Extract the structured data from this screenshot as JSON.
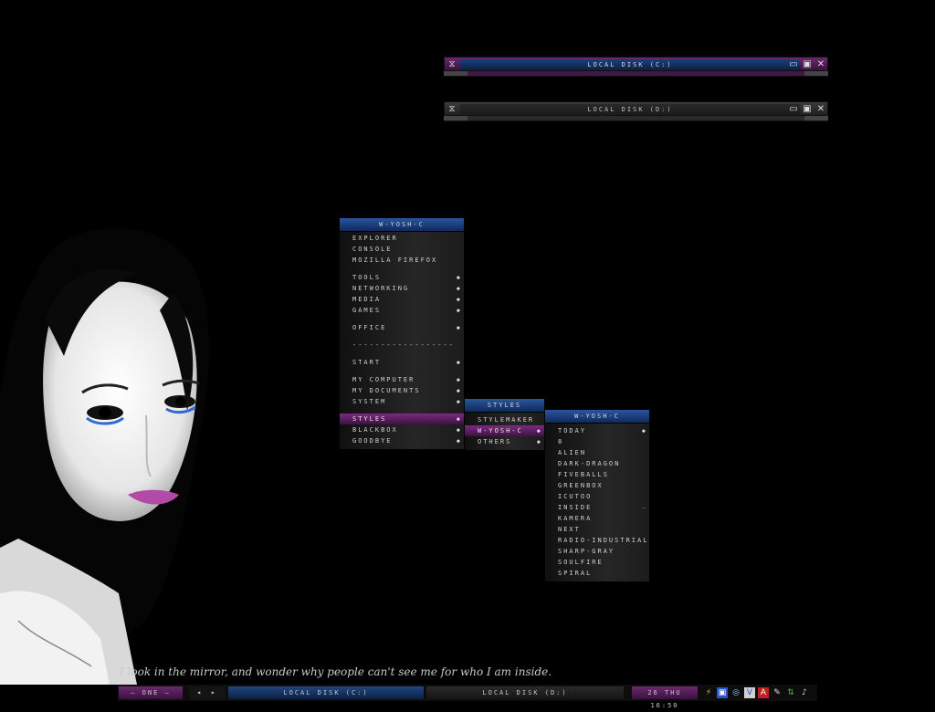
{
  "windows": [
    {
      "title": "LOCAL DISK (C:)",
      "active": true
    },
    {
      "title": "LOCAL DISK (D:)",
      "active": false
    }
  ],
  "window_controls": {
    "menu_icon": "⧖",
    "minimize": "▭",
    "maximize": "▣",
    "close": "✕"
  },
  "menu_main": {
    "title": "W-YOSH-C",
    "items": [
      {
        "label": "EXPLORER"
      },
      {
        "label": "CONSOLE"
      },
      {
        "label": "MOZILLA FIREFOX"
      },
      {
        "label": "TOOLS",
        "arrow": "◆"
      },
      {
        "label": "NETWORKING",
        "arrow": "◆"
      },
      {
        "label": "MEDIA",
        "arrow": "◆"
      },
      {
        "label": "GAMES",
        "arrow": "◆"
      },
      {
        "label": "OFFICE",
        "arrow": "◆"
      },
      {
        "label": "------------------"
      },
      {
        "label": "START",
        "arrow": "◆"
      },
      {
        "label": "MY COMPUTER",
        "arrow": "◆"
      },
      {
        "label": "MY DOCUMENTS",
        "arrow": "◆"
      },
      {
        "label": "SYSTEM",
        "arrow": "◆"
      },
      {
        "label": "STYLES",
        "arrow": "◆"
      },
      {
        "label": "BLACKBOX",
        "arrow": "◆"
      },
      {
        "label": "GOODBYE",
        "arrow": "◆"
      }
    ]
  },
  "menu_styles": {
    "title": "STYLES",
    "items": [
      {
        "label": "STYLEMAKER"
      },
      {
        "label": "W-YOSH-C",
        "arrow": "◆"
      },
      {
        "label": "OTHERS",
        "arrow": "◆"
      }
    ]
  },
  "menu_wyoshc": {
    "title": "W-YOSH-C",
    "items": [
      {
        "label": "TODAY",
        "arrow": "◆"
      },
      {
        "label": "8"
      },
      {
        "label": "ALIEN"
      },
      {
        "label": "DARK-DRAGON"
      },
      {
        "label": "FIVEBALLS"
      },
      {
        "label": "GREENBOX"
      },
      {
        "label": "ICUTOO"
      },
      {
        "label": "INSIDE",
        "mark": "—"
      },
      {
        "label": "KAMERA"
      },
      {
        "label": "NEXT"
      },
      {
        "label": "RADIO-INDUSTRIAL"
      },
      {
        "label": "SHARP-GRAY"
      },
      {
        "label": "SOULFIRE"
      },
      {
        "label": "SPIRAL"
      }
    ]
  },
  "desktop": {
    "quote": "I look in the mirror, and wonder why people can't see me for who I am inside."
  },
  "taskbar": {
    "workspace": "– ONE –",
    "workspace_nav": "◂ ▸",
    "tasks": [
      "LOCAL DISK (C:)",
      "LOCAL DISK (D:)"
    ],
    "clock": "26 THU 16:50",
    "tray_icons": [
      "lightning-icon",
      "monitor-icon",
      "globe-icon",
      "shield-icon",
      "antivirus-icon",
      "chat-icon",
      "network-icon",
      "speaker-icon"
    ]
  },
  "colors": {
    "accent_purple": "#6a2a6c",
    "accent_blue": "#1e3f7a",
    "background": "#000000"
  }
}
